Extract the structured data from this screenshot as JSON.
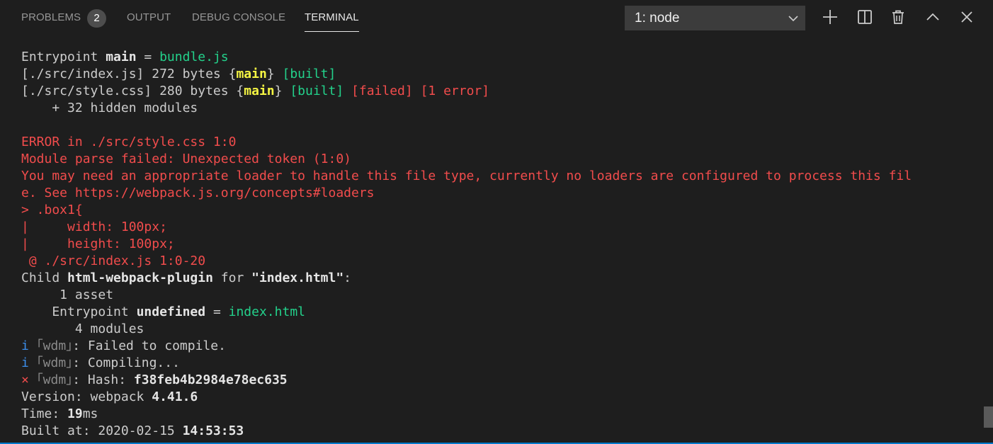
{
  "tabs": {
    "problems": "PROBLEMS",
    "problems_count": "2",
    "output": "OUTPUT",
    "debug_console": "DEBUG CONSOLE",
    "terminal": "TERMINAL"
  },
  "terminal_select": {
    "value": "1: node"
  },
  "actions": [
    "plus-icon",
    "split-icon",
    "trash-icon",
    "chevron-up-icon",
    "close-icon"
  ],
  "colors": {
    "background": "#1e1e1e",
    "green": "#23d18b",
    "yellow": "#f5f543",
    "red": "#f14c4c",
    "blue": "#3b8eea",
    "accent": "#007acc"
  },
  "lines": [
    [
      {
        "t": "Entrypoint "
      },
      {
        "t": "main",
        "c": "b"
      },
      {
        "t": " = "
      },
      {
        "t": "bundle.js",
        "c": "g"
      }
    ],
    [
      {
        "t": "[./src/index.js] 272 bytes {"
      },
      {
        "t": "main",
        "c": "y"
      },
      {
        "t": "} "
      },
      {
        "t": "[built]",
        "c": "g"
      }
    ],
    [
      {
        "t": "[./src/style.css] 280 bytes {"
      },
      {
        "t": "main",
        "c": "y"
      },
      {
        "t": "} "
      },
      {
        "t": "[built]",
        "c": "g"
      },
      {
        "t": " "
      },
      {
        "t": "[failed]",
        "c": "r"
      },
      {
        "t": " "
      },
      {
        "t": "[1 error]",
        "c": "r"
      }
    ],
    [
      {
        "t": "    + 32 hidden modules"
      }
    ],
    [
      {
        "t": ""
      }
    ],
    [
      {
        "t": "ERROR in ./src/style.css 1:0",
        "c": "r"
      }
    ],
    [
      {
        "t": "Module parse failed: Unexpected token (1:0)",
        "c": "r"
      }
    ],
    [
      {
        "t": "You may need an appropriate loader to handle this file type, currently no loaders are configured to process this fil",
        "c": "r"
      }
    ],
    [
      {
        "t": "e. See https://webpack.js.org/concepts#loaders",
        "c": "r"
      }
    ],
    [
      {
        "t": "> .box1{",
        "c": "r"
      }
    ],
    [
      {
        "t": "|     width: 100px;",
        "c": "r"
      }
    ],
    [
      {
        "t": "|     height: 100px;",
        "c": "r"
      }
    ],
    [
      {
        "t": " @ ./src/index.js 1:0-20",
        "c": "r"
      }
    ],
    [
      {
        "t": "Child "
      },
      {
        "t": "html-webpack-plugin",
        "c": "b"
      },
      {
        "t": " for "
      },
      {
        "t": "\"index.html\"",
        "c": "b"
      },
      {
        "t": ":"
      }
    ],
    [
      {
        "t": "     1 asset"
      }
    ],
    [
      {
        "t": "    Entrypoint "
      },
      {
        "t": "undefined",
        "c": "b"
      },
      {
        "t": " = "
      },
      {
        "t": "index.html",
        "c": "g"
      }
    ],
    [
      {
        "t": "       4 modules"
      }
    ],
    [
      {
        "t": "i ",
        "c": "bl"
      },
      {
        "t": "｢wdm｣",
        "c": "gr"
      },
      {
        "t": ": Failed to compile."
      }
    ],
    [
      {
        "t": "i ",
        "c": "bl"
      },
      {
        "t": "｢wdm｣",
        "c": "gr"
      },
      {
        "t": ": Compiling..."
      }
    ],
    [
      {
        "t": "× ",
        "c": "r"
      },
      {
        "t": "｢wdm｣",
        "c": "gr"
      },
      {
        "t": ": Hash: "
      },
      {
        "t": "f38feb4b2984e78ec635",
        "c": "b"
      }
    ],
    [
      {
        "t": "Version: webpack "
      },
      {
        "t": "4.41.6",
        "c": "b"
      }
    ],
    [
      {
        "t": "Time: "
      },
      {
        "t": "19",
        "c": "b"
      },
      {
        "t": "ms"
      }
    ],
    [
      {
        "t": "Built at: 2020-02-15 "
      },
      {
        "t": "14:53:53",
        "c": "b"
      }
    ]
  ]
}
